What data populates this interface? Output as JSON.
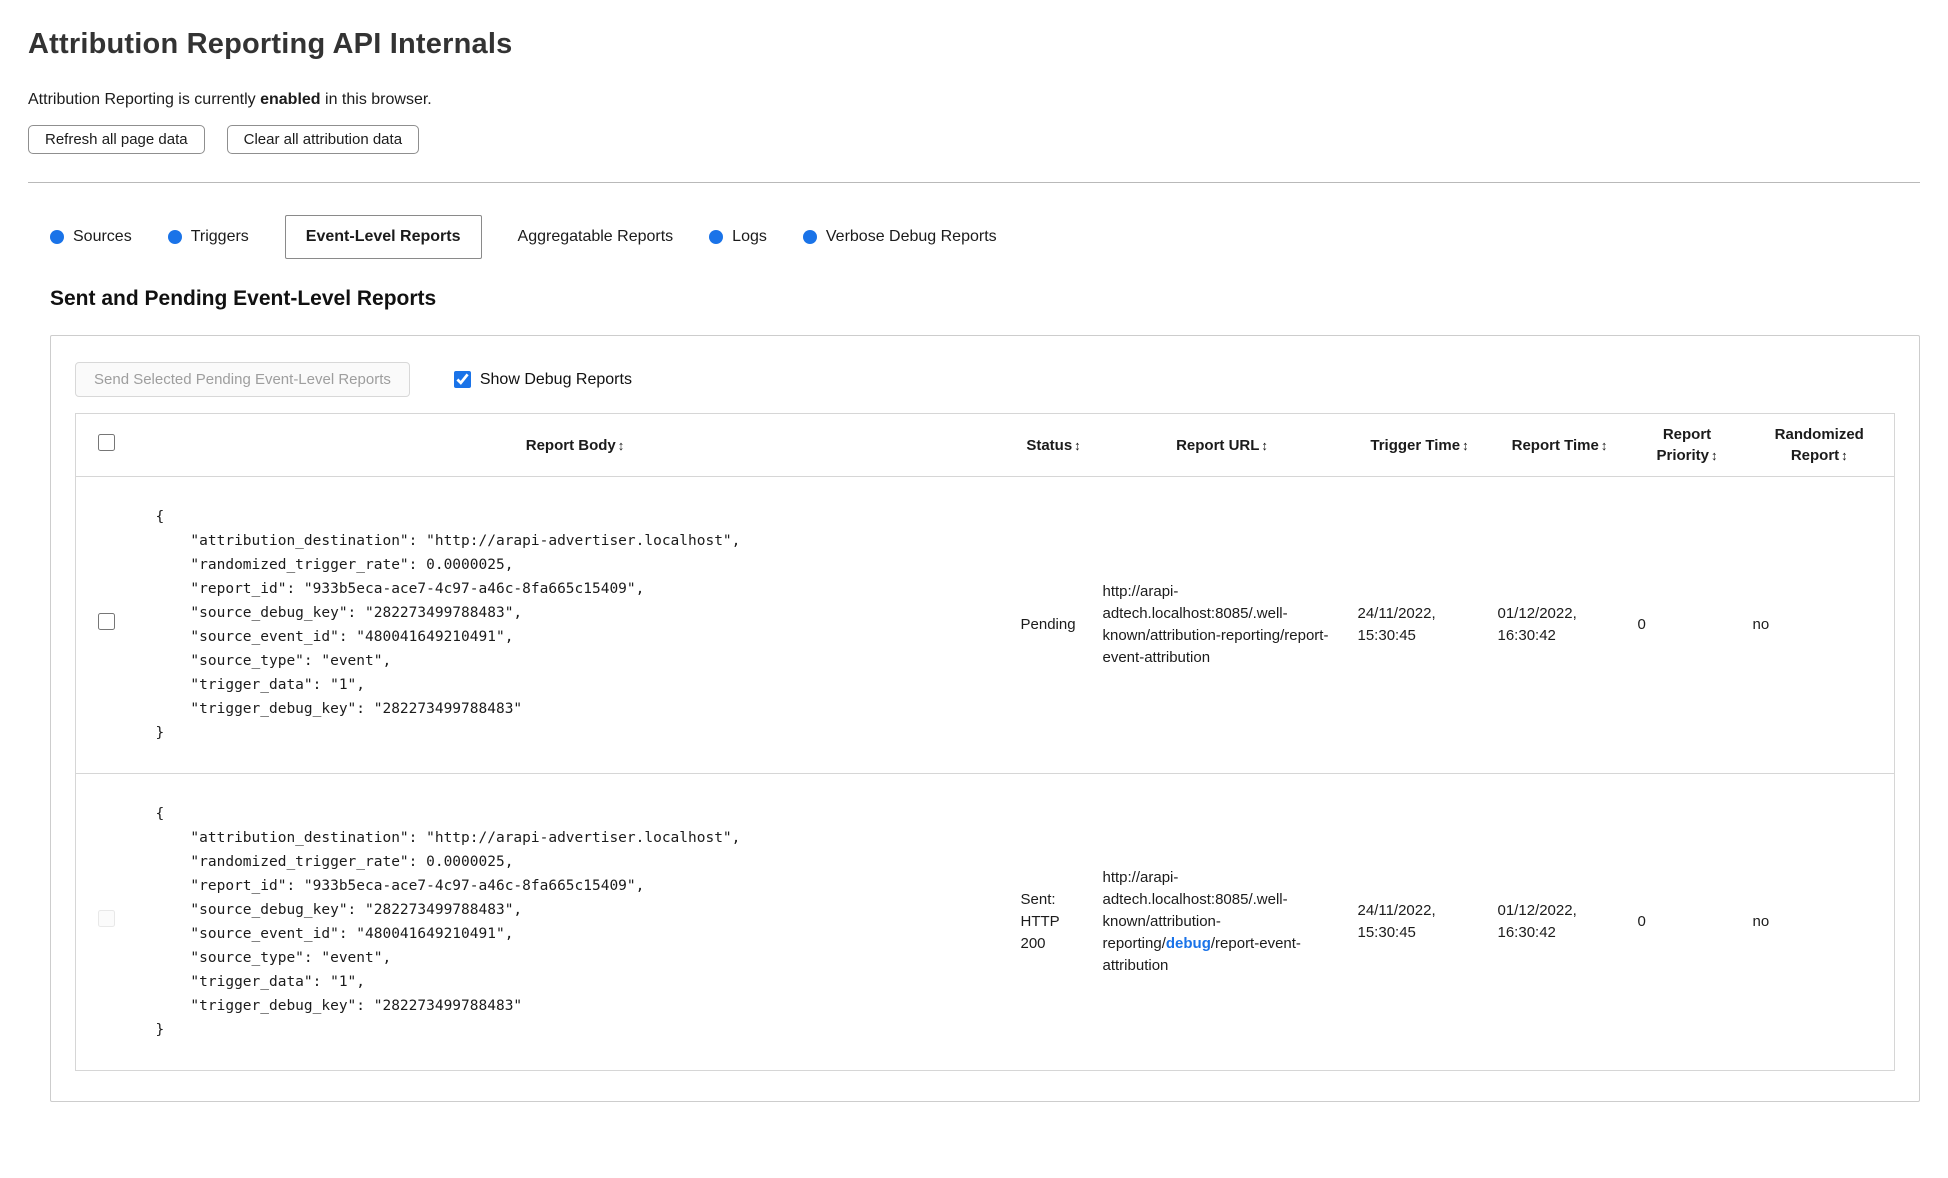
{
  "page": {
    "title": "Attribution Reporting API Internals",
    "status_prefix": "Attribution Reporting is currently ",
    "status_bold": "enabled",
    "status_suffix": " in this browser."
  },
  "toolbar": {
    "refresh_label": "Refresh all page data",
    "clear_label": "Clear all attribution data"
  },
  "colors": {
    "accent_blue": "#1a73e8"
  },
  "tabs": [
    {
      "label": "Sources",
      "has_dot": true,
      "active": false
    },
    {
      "label": "Triggers",
      "has_dot": true,
      "active": false
    },
    {
      "label": "Event-Level Reports",
      "has_dot": false,
      "active": true
    },
    {
      "label": "Aggregatable Reports",
      "has_dot": false,
      "active": false
    },
    {
      "label": "Logs",
      "has_dot": true,
      "active": false
    },
    {
      "label": "Verbose Debug Reports",
      "has_dot": true,
      "active": false
    }
  ],
  "section": {
    "heading": "Sent and Pending Event-Level Reports",
    "send_button_label": "Send Selected Pending Event-Level Reports",
    "show_debug_label": "Show Debug Reports",
    "show_debug_checked": true
  },
  "table": {
    "sort_icon": "↕",
    "headers": [
      "Report Body",
      "Status",
      "Report URL",
      "Trigger Time",
      "Report Time",
      "Report Priority",
      "Randomized Report"
    ],
    "rows": [
      {
        "selected": false,
        "checkbox_disabled": false,
        "report_body": "{\n    \"attribution_destination\": \"http://arapi-advertiser.localhost\",\n    \"randomized_trigger_rate\": 0.0000025,\n    \"report_id\": \"933b5eca-ace7-4c97-a46c-8fa665c15409\",\n    \"source_debug_key\": \"282273499788483\",\n    \"source_event_id\": \"480041649210491\",\n    \"source_type\": \"event\",\n    \"trigger_data\": \"1\",\n    \"trigger_debug_key\": \"282273499788483\"\n}",
        "status": "Pending",
        "url_prefix": "http://arapi-adtech.localhost:8085/.well-known/attribution-reporting/report-event-attribution",
        "url_debug": "",
        "url_suffix": "",
        "trigger_time": "24/11/2022, 15:30:45",
        "report_time": "01/12/2022, 16:30:42",
        "priority": "0",
        "randomized": "no"
      },
      {
        "selected": false,
        "checkbox_disabled": true,
        "report_body": "{\n    \"attribution_destination\": \"http://arapi-advertiser.localhost\",\n    \"randomized_trigger_rate\": 0.0000025,\n    \"report_id\": \"933b5eca-ace7-4c97-a46c-8fa665c15409\",\n    \"source_debug_key\": \"282273499788483\",\n    \"source_event_id\": \"480041649210491\",\n    \"source_type\": \"event\",\n    \"trigger_data\": \"1\",\n    \"trigger_debug_key\": \"282273499788483\"\n}",
        "status": "Sent: HTTP 200",
        "url_prefix": "http://arapi-adtech.localhost:8085/.well-known/attribution-reporting/",
        "url_debug": "debug",
        "url_suffix": "/report-event-attribution",
        "trigger_time": "24/11/2022, 15:30:45",
        "report_time": "01/12/2022, 16:30:42",
        "priority": "0",
        "randomized": "no"
      }
    ]
  }
}
